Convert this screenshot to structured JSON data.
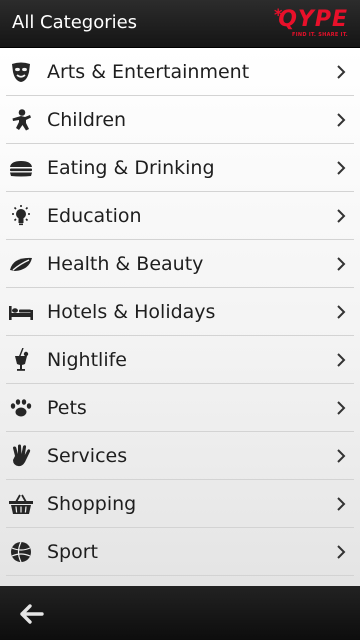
{
  "header": {
    "title": "All Categories",
    "logo_text": "QYPE",
    "logo_star": "*",
    "logo_tagline": "FIND IT. SHARE IT.",
    "logo_color": "#e8102a"
  },
  "categories": [
    {
      "label": "Arts & Entertainment",
      "icon": "theater-mask-icon"
    },
    {
      "label": "Children",
      "icon": "child-figure-icon"
    },
    {
      "label": "Eating & Drinking",
      "icon": "burger-icon"
    },
    {
      "label": "Education",
      "icon": "lightbulb-icon"
    },
    {
      "label": "Health & Beauty",
      "icon": "leaf-icon"
    },
    {
      "label": "Hotels & Holidays",
      "icon": "bed-icon"
    },
    {
      "label": "Nightlife",
      "icon": "cocktail-icon"
    },
    {
      "label": "Pets",
      "icon": "paw-icon"
    },
    {
      "label": "Services",
      "icon": "hand-icon"
    },
    {
      "label": "Shopping",
      "icon": "basket-icon"
    },
    {
      "label": "Sport",
      "icon": "ball-icon"
    }
  ],
  "footer": {
    "back_icon": "back-arrow-icon"
  }
}
